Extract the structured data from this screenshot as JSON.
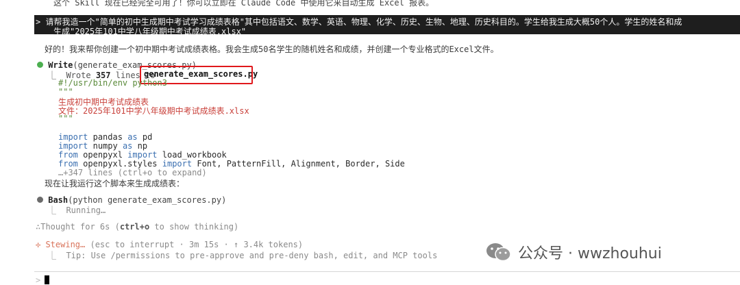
{
  "top_text": "这个 Skill 现在已经完全可用了！你可以立即在 Claude Code 中使用它来自动生成 Excel 报表。",
  "prompt": {
    "marker": ">",
    "line1": "请帮我造一个\"简单的初中生成期中考试学习成绩表格\"其中包括语文、数学、英语、物理、化学、历史、生物、地理、历史科目的。学生给我生成大概50个人。学生的姓名和成",
    "line2": "生成\"2025年101中学八年级期中考试成绩表.xlsx\""
  },
  "response_text": "好的！我来帮你创建一个初中期中考试成绩表格。我会生成50名学生的随机姓名和成绩，并创建一个专业格式的Excel文件。",
  "write_tool": {
    "name": "Write",
    "args": "(generate_exam_scores.py)",
    "result_prefix": "⎿  Wrote ",
    "line_count": "357",
    "result_mid": " lines to ",
    "filename": "generate_exam_scores.py",
    "code": [
      {
        "text": "#!/usr/bin/env python3",
        "style": "green"
      },
      {
        "text": "\"\"\"",
        "style": "green"
      },
      {
        "text": "生成初中期中考试成绩表",
        "style": "red"
      },
      {
        "text": "文件：2025年101中学八年级期中考试成绩表.xlsx",
        "style": "red"
      },
      {
        "text": "\"\"\"",
        "style": "green"
      },
      {
        "text": "",
        "style": "plain"
      },
      {
        "text": "import pandas as pd",
        "style": "import"
      },
      {
        "text": "import numpy as np",
        "style": "import"
      },
      {
        "text": "from openpyxl import load_workbook",
        "style": "from"
      },
      {
        "text": "from openpyxl.styles import Font, PatternFill, Alignment, Border, Side",
        "style": "from"
      },
      {
        "text": "…+347 lines (ctrl+o to expand)",
        "style": "muted"
      }
    ]
  },
  "run_text": "现在让我运行这个脚本来生成成绩表：",
  "bash_tool": {
    "name": "Bash",
    "args": "(python generate_exam_scores.py)",
    "status": "⎿  Running…"
  },
  "thought": {
    "prefix": "∴Thought for 6s (",
    "key": "ctrl+o",
    "suffix": " to show thinking)"
  },
  "stewing": {
    "label": "✢ Stewing…",
    "detail": " (esc to interrupt · 3m 15s · ↑ 3.4k tokens)",
    "tip": "⎿  Tip: Use /permissions to pre-approve and pre-deny bash, edit, and MCP tools"
  },
  "input": {
    "arrow": ">"
  },
  "watermark": {
    "text": "公众号 · wwzhouhui",
    "icon": "wechat-icon"
  },
  "colors": {
    "highlight": "#e0181c",
    "prompt_bg": "#1e1e1e",
    "success_dot": "#4caf50",
    "stewing": "#d9735a"
  }
}
